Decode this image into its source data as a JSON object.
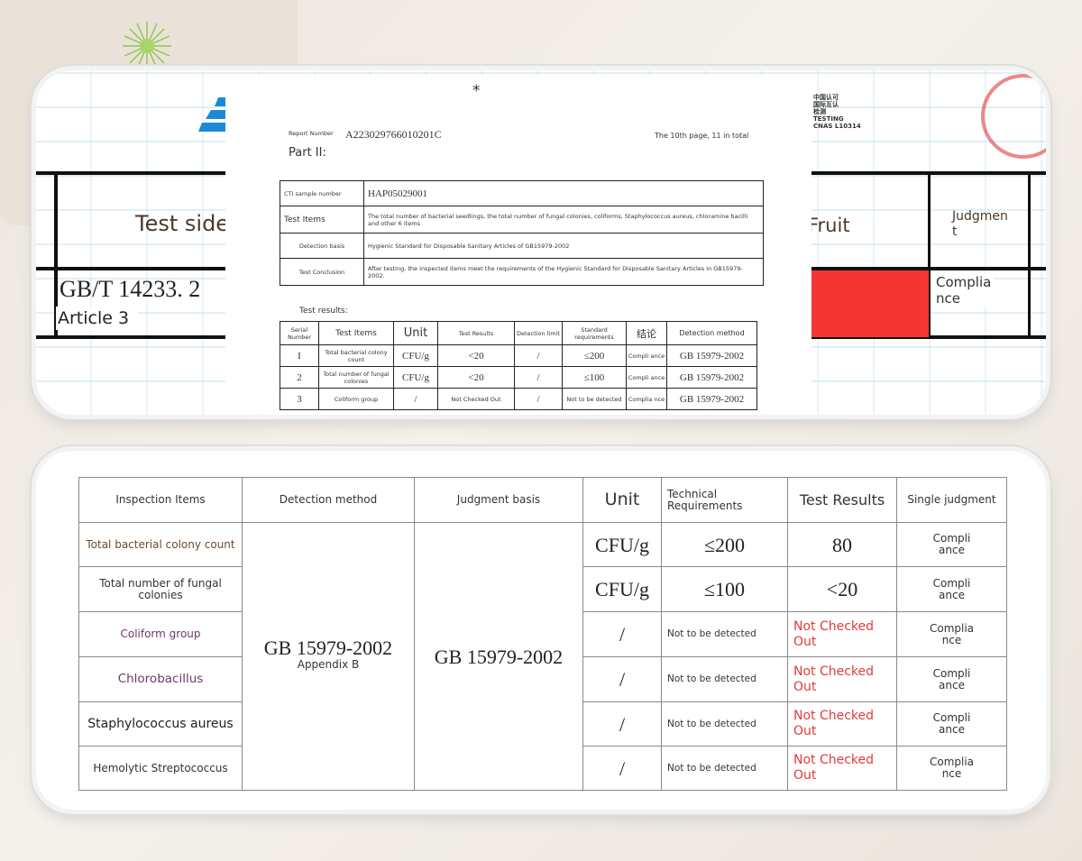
{
  "top_image": {
    "background": {
      "test_side": "Test side",
      "gbt": "GB/T  14233. 2",
      "article": "Article 3",
      "fruit": "Fruit",
      "judgment": "Judgmen\nt",
      "compliance": "Complia\nnce",
      "logo_right_lines": [
        "中国认可",
        "国际互认",
        "检测",
        "TESTING",
        "CNAS L10314"
      ]
    },
    "report": {
      "asterisk": "*",
      "report_number_label": "Report Number",
      "report_number": "A223029766010201C",
      "page_info": "The 10th page, 11 in total",
      "part": "Part II:",
      "info_rows": [
        {
          "label": "CTI sample number",
          "value": "HAP05029001"
        },
        {
          "label": "Test Items",
          "value": "The total number of bacterial seedlings, the total number of fungal colonies, coliforms, Staphylococcus aureus, chloramine bacilli and other 6 items"
        },
        {
          "label": "Detection basis",
          "value": "Hygienic Standard for Disposable Sanitary Articles of GB15979-2002"
        },
        {
          "label": "Test Conclusion",
          "value": "After testing, the inspected items meet the requirements of the Hygienic Standard for Disposable Sanitary Articles in GB15979-2002."
        }
      ],
      "results_label": "Test results:",
      "results_headers": [
        "Serial Number",
        "Test Items",
        "Unit",
        "Test Results",
        "Detection limit",
        "Standard requirements",
        "结论",
        "Detection method"
      ],
      "results_rows": [
        [
          "I",
          "Total bacterial colony count",
          "CFU/g",
          "<20",
          "/",
          "≤200",
          "Compli ance",
          "GB 15979-2002"
        ],
        [
          "2",
          "Total number of fungal colonies",
          "CFU/g",
          "<20",
          "/",
          "≤100",
          "Compli ance",
          "GB 15979-2002"
        ],
        [
          "3",
          "Coliform group",
          "/",
          "Not Checked Out",
          "/",
          "Not to be detected",
          "Complia nce",
          "GB 15979-2002"
        ]
      ]
    }
  },
  "table": {
    "headers": [
      "Inspection Items",
      "Detection method",
      "Judgment basis",
      "Unit",
      "Technical Requirements",
      "Test Results",
      "Single judgment"
    ],
    "method": "GB 15979-2002",
    "method_note": "Appendix B",
    "basis": "GB 15979-2002",
    "rows": [
      {
        "item": "Total bacterial colony count",
        "unit": "CFU/g",
        "requirement": "≤200",
        "result": "80",
        "judgment": "Compli\nance"
      },
      {
        "item": "Total number of fungal colonies",
        "unit": "CFU/g",
        "requirement": "≤100",
        "result": "<20",
        "judgment": "Compli\nance"
      },
      {
        "item": "Coliform group",
        "unit": "/",
        "requirement": "Not to be detected",
        "result": "Not Checked Out",
        "judgment": "Complia\nnce"
      },
      {
        "item": "Chlorobacillus",
        "unit": "/",
        "requirement": "Not to be detected",
        "result": "Not Checked Out",
        "judgment": "Compli\nance"
      },
      {
        "item": "Staphylococcus aureus",
        "unit": "/",
        "requirement": "Not to be detected",
        "result": "Not Checked Out",
        "judgment": "Compli\nance"
      },
      {
        "item": "Hemolytic Streptococcus",
        "unit": "/",
        "requirement": "Not to be detected",
        "result": "Not Checked Out",
        "judgment": "Complia\nnce"
      }
    ]
  },
  "colors": {
    "red_text": "#e23b3b",
    "red_block": "#f53434"
  }
}
